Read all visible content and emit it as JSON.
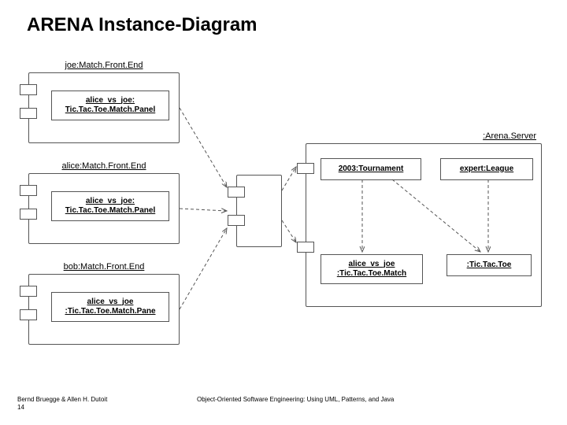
{
  "title": "ARENA Instance-Diagram",
  "left_components": [
    {
      "header": "joe:Match.Front.End",
      "inner_line1": "alice_vs_joe:",
      "inner_line2": "Tic.Tac.Toe.Match.Panel"
    },
    {
      "header": "alice:Match.Front.End",
      "inner_line1": "alice_vs_joe:",
      "inner_line2": "Tic.Tac.Toe.Match.Panel"
    },
    {
      "header": "bob:Match.Front.End",
      "inner_line1": "alice_vs_joe",
      "inner_line2": ":Tic.Tac.Toe.Match.Pane"
    }
  ],
  "server": {
    "header": ":Arena.Server",
    "tournament": "2003:Tournament",
    "league": "expert:League",
    "match_line1": "alice_vs_joe",
    "match_line2": ":Tic.Tac.Toe.Match",
    "game": ":Tic.Tac.Toe"
  },
  "footer": {
    "authors": "Bernd Bruegge & Allen H. Dutoit",
    "page": "14",
    "book": "Object-Oriented Software Engineering: Using UML, Patterns, and Java"
  }
}
